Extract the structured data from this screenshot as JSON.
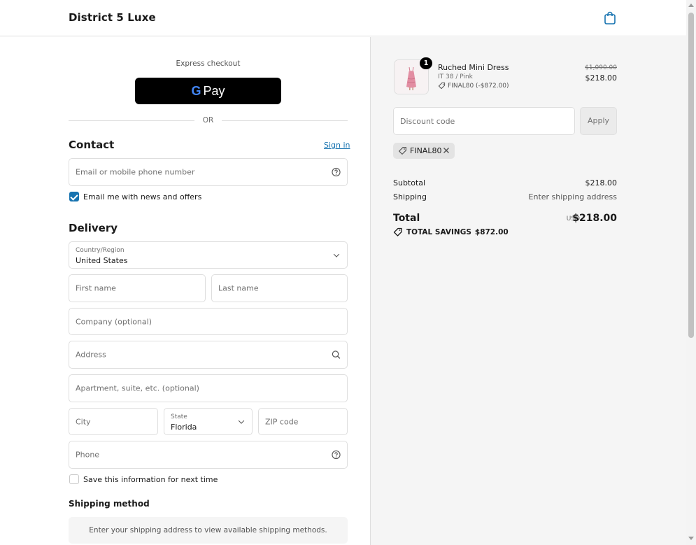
{
  "header": {
    "brand": "District 5 Luxe",
    "cart_icon": "shopping-bag-icon"
  },
  "express": {
    "label": "Express checkout",
    "gpay_g": "G",
    "gpay_text": "Pay",
    "or": "OR"
  },
  "contact": {
    "title": "Contact",
    "sign_in": "Sign in",
    "email_placeholder": "Email or mobile phone number",
    "news_label": "Email me with news and offers",
    "news_checked": true
  },
  "delivery": {
    "title": "Delivery",
    "country_label": "Country/Region",
    "country_value": "United States",
    "first_name": "First name",
    "last_name": "Last name",
    "company": "Company (optional)",
    "address": "Address",
    "apartment": "Apartment, suite, etc. (optional)",
    "city": "City",
    "state_label": "State",
    "state_value": "Florida",
    "zip": "ZIP code",
    "phone": "Phone",
    "save_label": "Save this information for next time",
    "save_checked": false
  },
  "shipping": {
    "title": "Shipping method",
    "message": "Enter your shipping address to view available shipping methods."
  },
  "summary": {
    "product": {
      "qty": "1",
      "name": "Ruched Mini Dress",
      "variant": "IT 38 / Pink",
      "discount": "FINAL80 (-$872.00)",
      "old_price": "$1,090.00",
      "price": "$218.00"
    },
    "discount_placeholder": "Discount code",
    "apply": "Apply",
    "chip": "FINAL80",
    "subtotal_label": "Subtotal",
    "subtotal_value": "$218.00",
    "shipping_label": "Shipping",
    "shipping_value": "Enter shipping address",
    "total_label": "Total",
    "currency": "USD",
    "total_value": "$218.00",
    "savings_label": "TOTAL SAVINGS",
    "savings_value": "$872.00"
  },
  "colors": {
    "accent": "#1773b0",
    "panel": "#f5f5f5",
    "border": "#dedede"
  }
}
